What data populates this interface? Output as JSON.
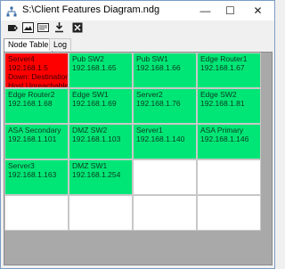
{
  "window": {
    "title": "S:\\Client Features Diagram.ndg",
    "minimize_glyph": "—",
    "maximize_glyph": "☐",
    "close_glyph": "✕"
  },
  "toolbar": {
    "buttons": [
      {
        "icon": "tag-icon"
      },
      {
        "icon": "image-icon"
      },
      {
        "icon": "card-icon"
      },
      {
        "icon": "download-icon"
      },
      {
        "icon": "close-box-icon"
      }
    ]
  },
  "tabs": [
    {
      "label": "Node Table",
      "active": true
    },
    {
      "label": "Log",
      "active": false
    }
  ],
  "colors": {
    "up": "#00e676",
    "down": "#ff0000",
    "empty": "#ffffff",
    "grid_background": "#a9a9a9"
  },
  "nodes": [
    {
      "name": "Server4",
      "ip": "192.168.1.5",
      "status": "down",
      "extra": [
        "Down: Destination",
        "Host Unreachable"
      ]
    },
    {
      "name": "Pub SW2",
      "ip": "192.168.1.65",
      "status": "up",
      "extra": []
    },
    {
      "name": "Pub SW1",
      "ip": "192.168.1.66",
      "status": "up",
      "extra": []
    },
    {
      "name": "Edge Router1",
      "ip": "192.168.1.67",
      "status": "up",
      "extra": []
    },
    {
      "name": "Edge Router2",
      "ip": "192.168.1.68",
      "status": "up",
      "extra": []
    },
    {
      "name": "Edge SW1",
      "ip": "192.168.1.69",
      "status": "up",
      "extra": []
    },
    {
      "name": "Server2",
      "ip": "192.168.1.76",
      "status": "up",
      "extra": []
    },
    {
      "name": "Edge SW2",
      "ip": "192.168.1.81",
      "status": "up",
      "extra": []
    },
    {
      "name": "ASA Secondary",
      "ip": "192.168.1.101",
      "status": "up",
      "extra": []
    },
    {
      "name": "DMZ SW2",
      "ip": "192.168.1.103",
      "status": "up",
      "extra": []
    },
    {
      "name": "Server1",
      "ip": "192.168.1.140",
      "status": "up",
      "extra": []
    },
    {
      "name": "ASA Primary",
      "ip": "192.168.1.146",
      "status": "up",
      "extra": []
    },
    {
      "name": "Server3",
      "ip": "192.168.1.163",
      "status": "up",
      "extra": []
    },
    {
      "name": "DMZ SW1",
      "ip": "192.168.1.254",
      "status": "up",
      "extra": []
    },
    {
      "name": "",
      "ip": "",
      "status": "empty",
      "extra": []
    },
    {
      "name": "",
      "ip": "",
      "status": "empty",
      "extra": []
    },
    {
      "name": "",
      "ip": "",
      "status": "empty",
      "extra": []
    },
    {
      "name": "",
      "ip": "",
      "status": "empty",
      "extra": []
    },
    {
      "name": "",
      "ip": "",
      "status": "empty",
      "extra": []
    },
    {
      "name": "",
      "ip": "",
      "status": "empty",
      "extra": []
    }
  ]
}
